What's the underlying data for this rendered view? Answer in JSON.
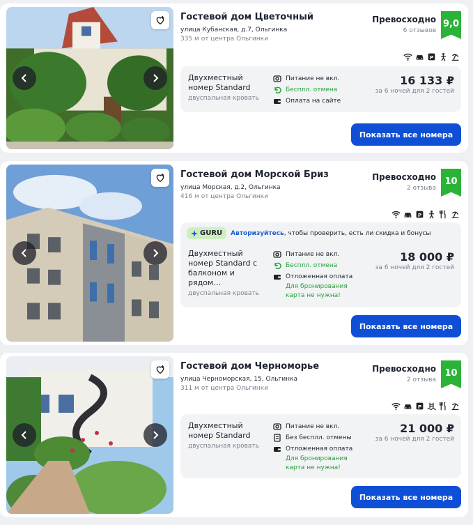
{
  "hotels": [
    {
      "name": "Гостевой дом Цветочный",
      "address": "улица Кубанская, д.7, Ольгинка",
      "distance": "335 м от центра Ольгинки",
      "rating_word": "Превосходно",
      "reviews": "6 отзывов",
      "score": "9,0",
      "room_type": "Двухместный номер Standard",
      "bed": "двуспальная кровать",
      "features": [
        "Питание не вкл.",
        "Бесплл. отмена",
        "Оплата на сайте"
      ],
      "price": "16 133 ₽",
      "price_note": "за 6 ночей для 2 гостей",
      "button": "Показать все номера"
    },
    {
      "name": "Гостевой дом Морской Бриз",
      "address": "улица Морская, д.2, Ольгинка",
      "distance": "416 м от центра Ольгинки",
      "rating_word": "Превосходно",
      "reviews": "2 отзыва",
      "score": "10",
      "guru_badge": "GURU",
      "guru_link": "Авторизуйтесь",
      "guru_text": ", чтобы проверить, есть ли скидка и бонусы",
      "room_type": "Двухместный номер Standard с балконом и рядом…",
      "bed": "двуспальная кровать",
      "features": [
        "Питание не вкл.",
        "Бесплл. отмена",
        "Отложенная оплата"
      ],
      "pay_note": "Для бронирования карта не нужна!",
      "price": "18 000 ₽",
      "price_note": "за 6 ночей для 2 гостей",
      "button": "Показать все номера"
    },
    {
      "name": "Гостевой дом Черноморье",
      "address": "улица Черноморская, 15, Ольгинка",
      "distance": "311 м от центра Ольгинки",
      "rating_word": "Превосходно",
      "reviews": "2 отзыва",
      "score": "10",
      "room_type": "Двухместный номер Standard",
      "bed": "двуспальная кровать",
      "features": [
        "Питание не вкл.",
        "Без бесплл. отмены",
        "Отложенная оплата"
      ],
      "pay_note": "Для бронирования карта не нужна!",
      "price": "21 000 ₽",
      "price_note": "за 6 ночей для 2 гостей",
      "button": "Показать все номера"
    }
  ],
  "colors": {
    "accent": "#0f4fd6",
    "score_green": "#2bb338",
    "positive_green": "#25a03a",
    "guru_bg": "#cfeec2"
  },
  "icons": [
    "heart-plus-icon",
    "chevron-left-icon",
    "chevron-right-icon",
    "wifi-icon",
    "car-icon",
    "parking-icon",
    "playground-icon",
    "pool-icon",
    "beach-icon",
    "restaurant-icon",
    "meal-icon",
    "undo-icon",
    "no-refund-icon",
    "wallet-icon"
  ]
}
